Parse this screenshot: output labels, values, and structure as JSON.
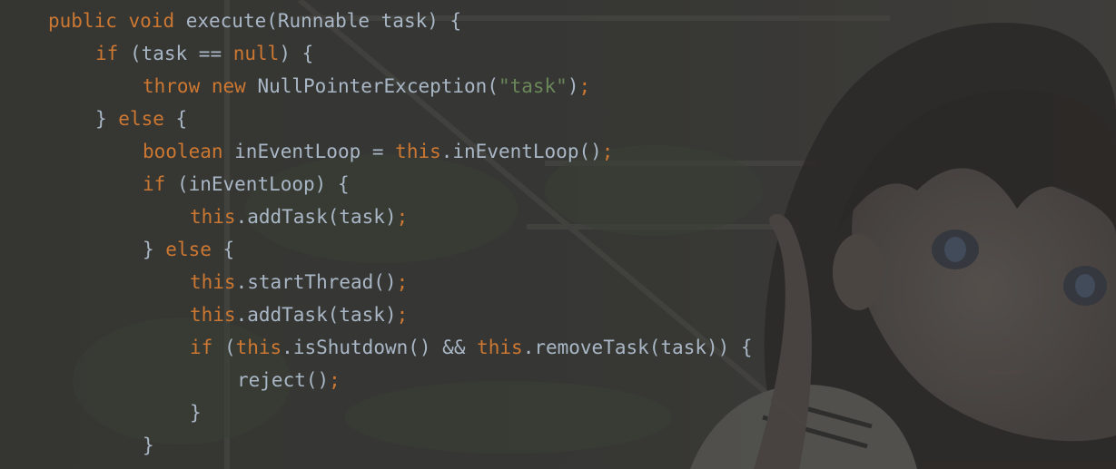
{
  "editor": {
    "language": "java",
    "theme_colors": {
      "keyword": "#cc7832",
      "plain": "#a9b7c6",
      "string": "#6a8759",
      "background": "#2b2b2b"
    },
    "lines": [
      {
        "indent": 0,
        "tokens": [
          {
            "t": "kw",
            "v": "public"
          },
          {
            "t": "plain",
            "v": " "
          },
          {
            "t": "kw",
            "v": "void"
          },
          {
            "t": "plain",
            "v": " execute(Runnable task) {"
          }
        ]
      },
      {
        "indent": 1,
        "tokens": [
          {
            "t": "kw",
            "v": "if"
          },
          {
            "t": "plain",
            "v": " (task == "
          },
          {
            "t": "kw",
            "v": "null"
          },
          {
            "t": "plain",
            "v": ") {"
          }
        ]
      },
      {
        "indent": 2,
        "tokens": [
          {
            "t": "kw",
            "v": "throw"
          },
          {
            "t": "plain",
            "v": " "
          },
          {
            "t": "kw",
            "v": "new"
          },
          {
            "t": "plain",
            "v": " NullPointerException("
          },
          {
            "t": "str",
            "v": "\"task\""
          },
          {
            "t": "plain",
            "v": ")"
          },
          {
            "t": "semi",
            "v": ";"
          }
        ]
      },
      {
        "indent": 1,
        "tokens": [
          {
            "t": "plain",
            "v": "} "
          },
          {
            "t": "kw",
            "v": "else"
          },
          {
            "t": "plain",
            "v": " {"
          }
        ]
      },
      {
        "indent": 2,
        "tokens": [
          {
            "t": "kw",
            "v": "boolean"
          },
          {
            "t": "plain",
            "v": " inEventLoop = "
          },
          {
            "t": "kw",
            "v": "this"
          },
          {
            "t": "plain",
            "v": ".inEventLoop()"
          },
          {
            "t": "semi",
            "v": ";"
          }
        ]
      },
      {
        "indent": 2,
        "tokens": [
          {
            "t": "kw",
            "v": "if"
          },
          {
            "t": "plain",
            "v": " (inEventLoop) {"
          }
        ]
      },
      {
        "indent": 3,
        "tokens": [
          {
            "t": "kw",
            "v": "this"
          },
          {
            "t": "plain",
            "v": ".addTask(task)"
          },
          {
            "t": "semi",
            "v": ";"
          }
        ]
      },
      {
        "indent": 2,
        "tokens": [
          {
            "t": "plain",
            "v": "} "
          },
          {
            "t": "kw",
            "v": "else"
          },
          {
            "t": "plain",
            "v": " {"
          }
        ]
      },
      {
        "indent": 3,
        "tokens": [
          {
            "t": "kw",
            "v": "this"
          },
          {
            "t": "plain",
            "v": ".startThread()"
          },
          {
            "t": "semi",
            "v": ";"
          }
        ]
      },
      {
        "indent": 3,
        "tokens": [
          {
            "t": "kw",
            "v": "this"
          },
          {
            "t": "plain",
            "v": ".addTask(task)"
          },
          {
            "t": "semi",
            "v": ";"
          }
        ]
      },
      {
        "indent": 3,
        "tokens": [
          {
            "t": "kw",
            "v": "if"
          },
          {
            "t": "plain",
            "v": " ("
          },
          {
            "t": "kw",
            "v": "this"
          },
          {
            "t": "plain",
            "v": ".isShutdown() && "
          },
          {
            "t": "kw",
            "v": "this"
          },
          {
            "t": "plain",
            "v": ".removeTask(task)) {"
          }
        ]
      },
      {
        "indent": 4,
        "tokens": [
          {
            "t": "plain",
            "v": "reject()"
          },
          {
            "t": "semi",
            "v": ";"
          }
        ]
      },
      {
        "indent": 3,
        "tokens": [
          {
            "t": "plain",
            "v": "}"
          }
        ]
      },
      {
        "indent": 2,
        "tokens": [
          {
            "t": "plain",
            "v": "}"
          }
        ]
      }
    ]
  },
  "background": {
    "image": "anime-girl-wallpaper"
  }
}
